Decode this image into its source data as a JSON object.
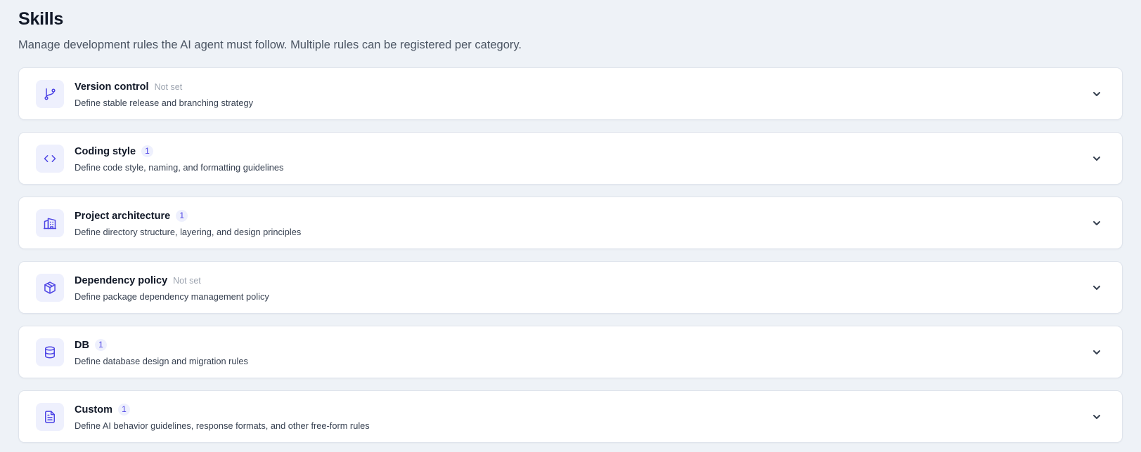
{
  "header": {
    "title": "Skills",
    "subtitle": "Manage development rules the AI agent must follow. Multiple rules can be registered per category."
  },
  "categories": [
    {
      "title": "Version control",
      "status": "Not set",
      "count": null,
      "description": "Define stable release and branching strategy",
      "icon": "git-branch-icon"
    },
    {
      "title": "Coding style",
      "status": null,
      "count": "1",
      "description": "Define code style, naming, and formatting guidelines",
      "icon": "code-icon"
    },
    {
      "title": "Project architecture",
      "status": null,
      "count": "1",
      "description": "Define directory structure, layering, and design principles",
      "icon": "building-icon"
    },
    {
      "title": "Dependency policy",
      "status": "Not set",
      "count": null,
      "description": "Define package dependency management policy",
      "icon": "package-icon"
    },
    {
      "title": "DB",
      "status": null,
      "count": "1",
      "description": "Define database design and migration rules",
      "icon": "database-icon"
    },
    {
      "title": "Custom",
      "status": null,
      "count": "1",
      "description": "Define AI behavior guidelines, response formats, and other free-form rules",
      "icon": "file-text-icon"
    }
  ],
  "colors": {
    "accent": "#4f46e5",
    "icon_bg": "#eef0fd",
    "page_bg": "#eef2f7"
  }
}
